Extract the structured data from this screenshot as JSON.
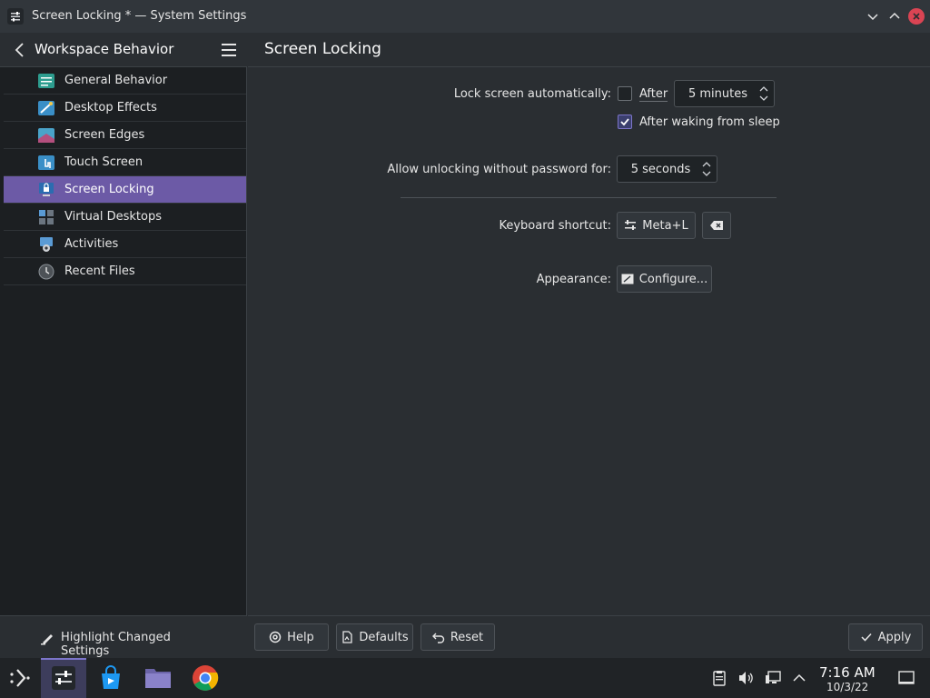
{
  "window": {
    "title": "Screen Locking * — System Settings"
  },
  "sidebar": {
    "header_title": "Workspace Behavior",
    "items": [
      {
        "label": "General Behavior",
        "icon": "general-behavior-icon"
      },
      {
        "label": "Desktop Effects",
        "icon": "desktop-effects-icon"
      },
      {
        "label": "Screen Edges",
        "icon": "screen-edges-icon"
      },
      {
        "label": "Touch Screen",
        "icon": "touch-screen-icon"
      },
      {
        "label": "Screen Locking",
        "icon": "screen-locking-icon",
        "active": true
      },
      {
        "label": "Virtual Desktops",
        "icon": "virtual-desktops-icon"
      },
      {
        "label": "Activities",
        "icon": "activities-icon"
      },
      {
        "label": "Recent Files",
        "icon": "recent-files-icon"
      }
    ],
    "highlight_label": "Highlight Changed Settings"
  },
  "main": {
    "title": "Screen Locking",
    "lock_auto_label": "Lock screen automatically:",
    "after_label": "After",
    "after_checked": false,
    "after_value": "5 minutes",
    "waking_label": "After waking from sleep",
    "waking_checked": true,
    "unlock_label": "Allow unlocking without password for:",
    "unlock_value": "5 seconds",
    "shortcut_label": "Keyboard shortcut:",
    "shortcut_value": "Meta+L",
    "appearance_label": "Appearance:",
    "configure_label": "Configure..."
  },
  "footer": {
    "help_label": "Help",
    "defaults_label": "Defaults",
    "reset_label": "Reset",
    "apply_label": "Apply"
  },
  "taskbar": {
    "time": "7:16 AM",
    "date": "10/3/22"
  },
  "colors": {
    "accent": "#6c5aa6",
    "window_bg": "#2a2e32",
    "sidebar_bg": "#1c1f22",
    "close_red": "#da4453"
  }
}
